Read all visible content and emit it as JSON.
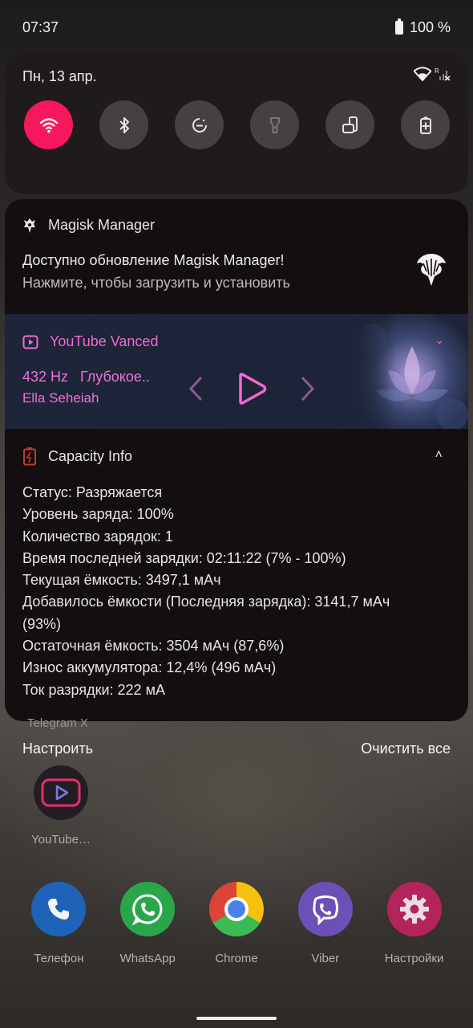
{
  "status_bar": {
    "time": "07:37",
    "battery": "100 %"
  },
  "quick_settings": {
    "date": "Пн, 13 апр.",
    "signal_label": "R",
    "tiles": [
      {
        "name": "wifi",
        "active": true
      },
      {
        "name": "bluetooth",
        "active": false
      },
      {
        "name": "do-not-disturb",
        "active": false
      },
      {
        "name": "flashlight",
        "active": false
      },
      {
        "name": "auto-rotate",
        "active": false
      },
      {
        "name": "battery-saver",
        "active": false
      }
    ]
  },
  "notifications": {
    "magisk": {
      "app_name": "Magisk Manager",
      "title": "Доступно обновление Magisk Manager!",
      "text": "Нажмите, чтобы загрузить и установить"
    },
    "media": {
      "app_name": "YouTube Vanced",
      "song": "432 Hz   Глубокое..",
      "artist": "Ella Seheiah",
      "accent_color": "#f06ad3"
    },
    "capacity": {
      "app_name": "Capacity Info",
      "lines": [
        "Статус: Разряжается",
        "Уровень заряда: 100%",
        "Количество зарядок: 1",
        "Время последней зарядки: 02:11:22 (7% - 100%)",
        "Текущая ёмкость: 3497,1 мАч",
        "Добавилось ёмкости (Последняя зарядка): 3141,7 мАч",
        "(93%)",
        "Остаточная ёмкость: 3504 мАч (87,6%)",
        "Износ аккумулятора: 12,4% (496 мАч)",
        "Ток разрядки: 222 мА"
      ]
    }
  },
  "home": {
    "telegram_label": "Telegram X",
    "configure_label": "Настроить",
    "clear_all_label": "Очистить все",
    "youtube_label": "YouTube…",
    "dock": [
      {
        "label": "Телефон",
        "icon": "phone-icon",
        "color": "#1e63b8"
      },
      {
        "label": "WhatsApp",
        "icon": "whatsapp-icon",
        "color": "#2aa64a"
      },
      {
        "label": "Chrome",
        "icon": "chrome-icon",
        "color": "#db4437"
      },
      {
        "label": "Viber",
        "icon": "viber-icon",
        "color": "#6c50b8"
      },
      {
        "label": "Настройки",
        "icon": "settings-gear-icon",
        "color": "#b3245a"
      }
    ]
  }
}
